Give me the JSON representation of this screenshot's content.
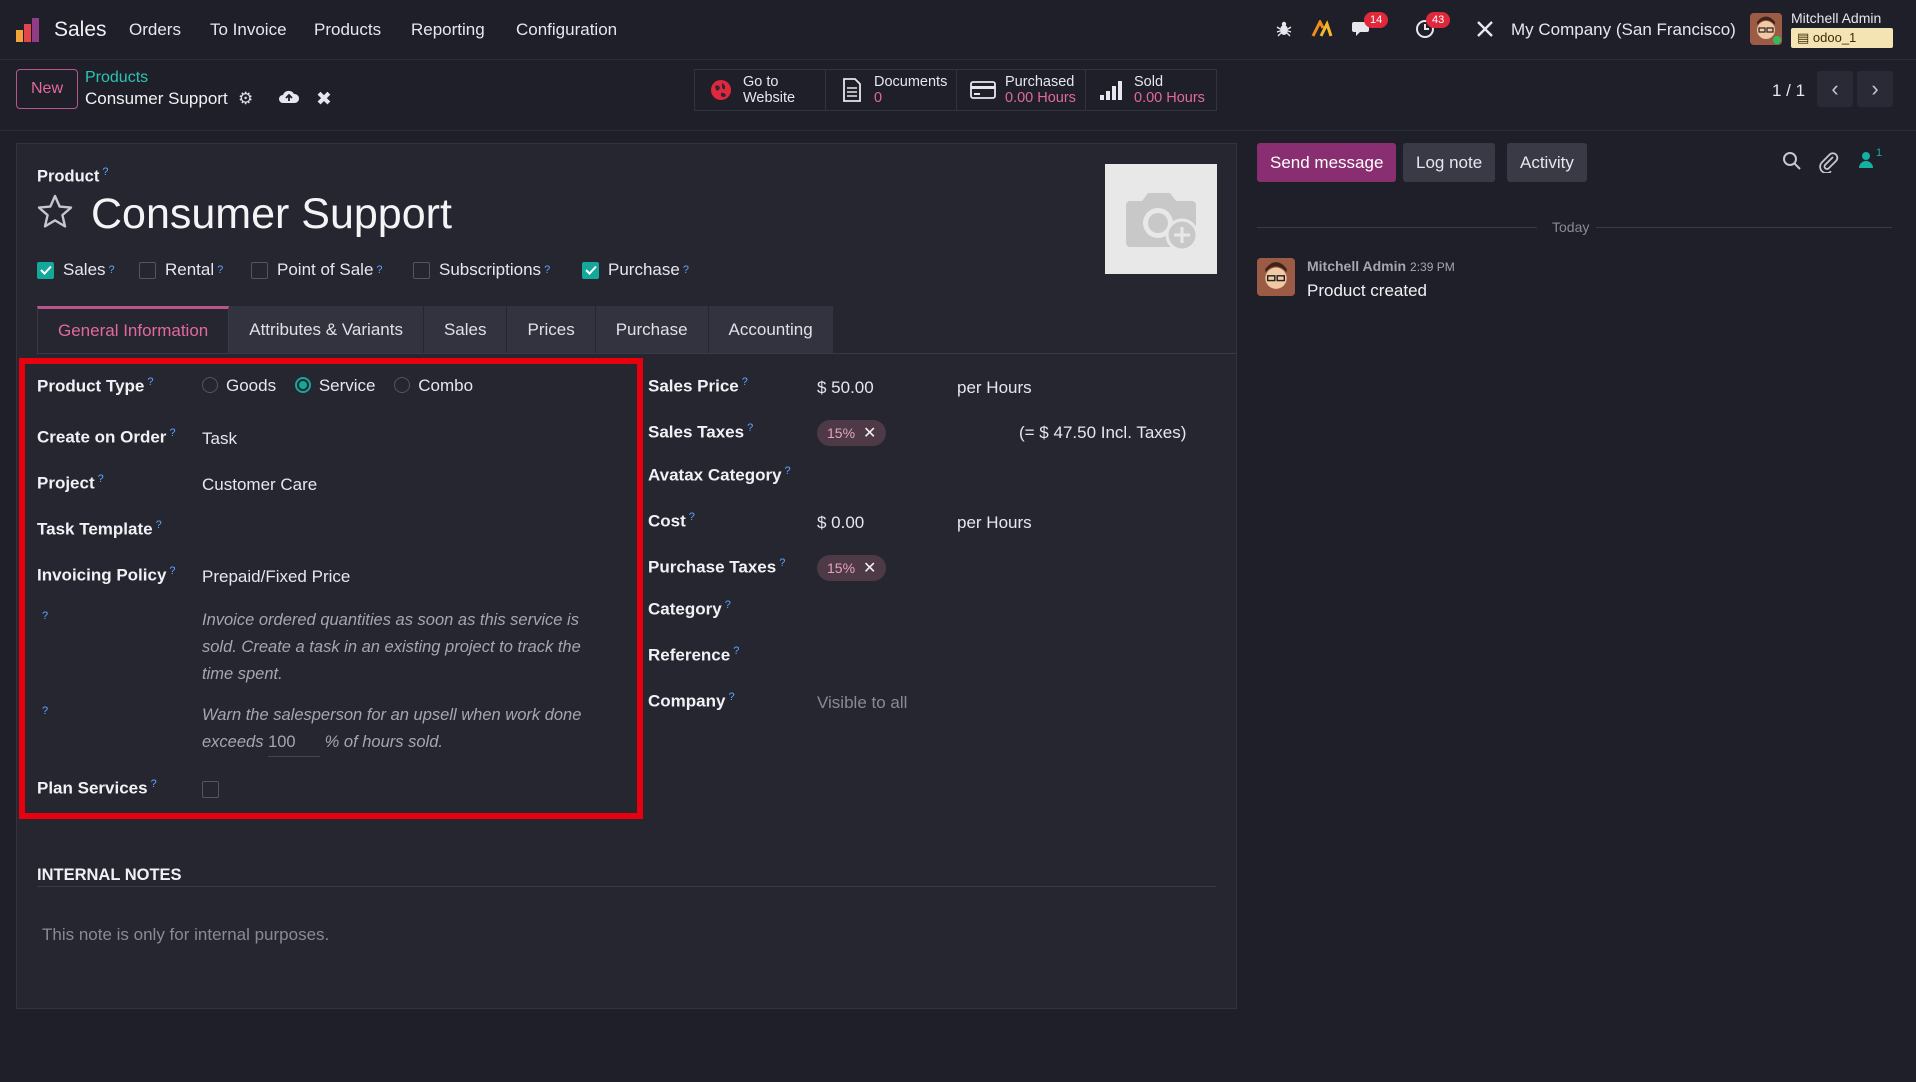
{
  "topbar": {
    "app_name": "Sales",
    "menu": [
      "Orders",
      "To Invoice",
      "Products",
      "Reporting",
      "Configuration"
    ],
    "messages_count": "14",
    "activities_count": "43",
    "company": "My Company (San Francisco)",
    "user_name": "Mitchell Admin",
    "database": "odoo_1"
  },
  "control": {
    "new_label": "New",
    "breadcrumb_parent": "Products",
    "breadcrumb_current": "Consumer Support",
    "smart_buttons": [
      {
        "line1": "Go to",
        "line2": "Website"
      },
      {
        "line1": "Documents",
        "line2": "0"
      },
      {
        "line1": "Purchased",
        "line2": "0.00 Hours"
      },
      {
        "line1": "Sold",
        "line2": "0.00 Hours"
      }
    ],
    "pager": "1 / 1"
  },
  "form": {
    "product_label": "Product",
    "help_mark": "?",
    "product_name": "Consumer Support",
    "checkboxes": [
      {
        "label": "Sales",
        "checked": true
      },
      {
        "label": "Rental",
        "checked": false
      },
      {
        "label": "Point of Sale",
        "checked": false
      },
      {
        "label": "Subscriptions",
        "checked": false
      },
      {
        "label": "Purchase",
        "checked": true
      }
    ],
    "tabs": [
      "General Information",
      "Attributes & Variants",
      "Sales",
      "Prices",
      "Purchase",
      "Accounting"
    ],
    "left": {
      "product_type_label": "Product Type",
      "type_options": [
        "Goods",
        "Service",
        "Combo"
      ],
      "type_selected": "Service",
      "create_on_order_label": "Create on Order",
      "create_on_order_value": "Task",
      "project_label": "Project",
      "project_value": "Customer Care",
      "task_template_label": "Task Template",
      "invoicing_policy_label": "Invoicing Policy",
      "invoicing_policy_value": "Prepaid/Fixed Price",
      "invoicing_note_1": "Invoice ordered quantities as soon as this service is",
      "invoicing_note_2": "sold. Create a task in an existing project to track the",
      "invoicing_note_3": "time spent.",
      "upsell_note_1": "Warn the salesperson for an upsell when work done",
      "upsell_prefix": "exceeds",
      "upsell_value": "100",
      "upsell_suffix": "% of hours sold.",
      "plan_services_label": "Plan Services"
    },
    "right": {
      "sales_price_label": "Sales Price",
      "sales_price_value": "$ 50.00",
      "sales_price_unit": "per Hours",
      "sales_taxes_label": "Sales Taxes",
      "sales_tax_tag": "15%",
      "incl_taxes": "(= $ 47.50 Incl. Taxes)",
      "avatax_label": "Avatax Category",
      "cost_label": "Cost",
      "cost_value": "$ 0.00",
      "cost_unit": "per Hours",
      "purchase_taxes_label": "Purchase Taxes",
      "purchase_tax_tag": "15%",
      "category_label": "Category",
      "reference_label": "Reference",
      "company_label": "Company",
      "company_placeholder": "Visible to all"
    },
    "internal_notes_title": "INTERNAL NOTES",
    "internal_notes_placeholder": "This note is only for internal purposes."
  },
  "chatter": {
    "send_message": "Send message",
    "log_note": "Log note",
    "activity": "Activity",
    "followers_count": "1",
    "today": "Today",
    "message_author": "Mitchell Admin",
    "message_time": "2:39 PM",
    "message_body": "Product created"
  },
  "colors": {
    "accent": "#b8548e",
    "teal": "#14a89b",
    "highlight": "#e8000f"
  }
}
